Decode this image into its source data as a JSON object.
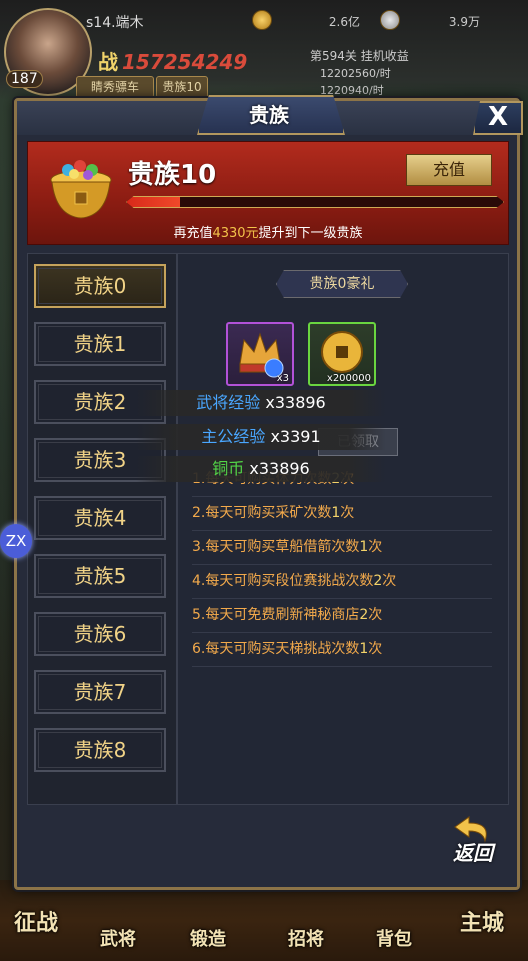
{
  "hud": {
    "server": "s14.端木",
    "gold": "2.6亿",
    "silver": "3.9万",
    "power_label": "战",
    "power_value": "157254249",
    "level": "187",
    "tag_nickname": "睛秀骠车",
    "tag_vip": "贵族10",
    "stage_title": "第594关 挂机收益",
    "stage_gold_rate": "12202560/时",
    "stage_other_rate": "1220940/时"
  },
  "modal": {
    "title": "贵族",
    "close_label": "X",
    "current_rank": "贵族10",
    "recharge_label": "充值",
    "progress_fraction": 0.14,
    "hint_prefix": "再充值",
    "hint_amount": "4330元",
    "hint_suffix": "提升到下一级贵族",
    "tabs": [
      "贵族0",
      "贵族1",
      "贵族2",
      "贵族3",
      "贵族4",
      "贵族5",
      "贵族6",
      "贵族7",
      "贵族8"
    ],
    "active_tab": 0,
    "gift_title": "贵族0豪礼",
    "items": [
      {
        "name": "general-gem-item",
        "count": "x3",
        "rarity": "purple"
      },
      {
        "name": "copper-coin-item",
        "count": "x200000",
        "rarity": "green"
      }
    ],
    "claimed_label": "已领取",
    "perks": [
      {
        "prefix": "1.每天可购买体力次数",
        "n": "2",
        "suffix": "次"
      },
      {
        "prefix": "2.每天可购买采矿次数",
        "n": "1",
        "suffix": "次"
      },
      {
        "prefix": "3.每天可购买草船借箭次数",
        "n": "1",
        "suffix": "次"
      },
      {
        "prefix": "4.每天可购买段位赛挑战次数",
        "n": "2",
        "suffix": "次"
      },
      {
        "prefix": "5.每天可免费刷新神秘商店",
        "n": "2",
        "suffix": "次"
      },
      {
        "prefix": "6.每天可购买天梯挑战次数",
        "n": "1",
        "suffix": "次"
      }
    ],
    "return_label": "返回"
  },
  "tooltips": [
    {
      "label": "武将经验",
      "value": "x33896",
      "color": "#4aa7ff"
    },
    {
      "label": "主公经验",
      "value": "x3391",
      "color": "#4aa7ff"
    },
    {
      "label": "铜币",
      "value": "x33896",
      "color": "#52d447"
    }
  ],
  "bottom_nav": [
    "征战",
    "武将",
    "锻造",
    "招将",
    "背包",
    "主城"
  ],
  "floating_badge": "ZX"
}
